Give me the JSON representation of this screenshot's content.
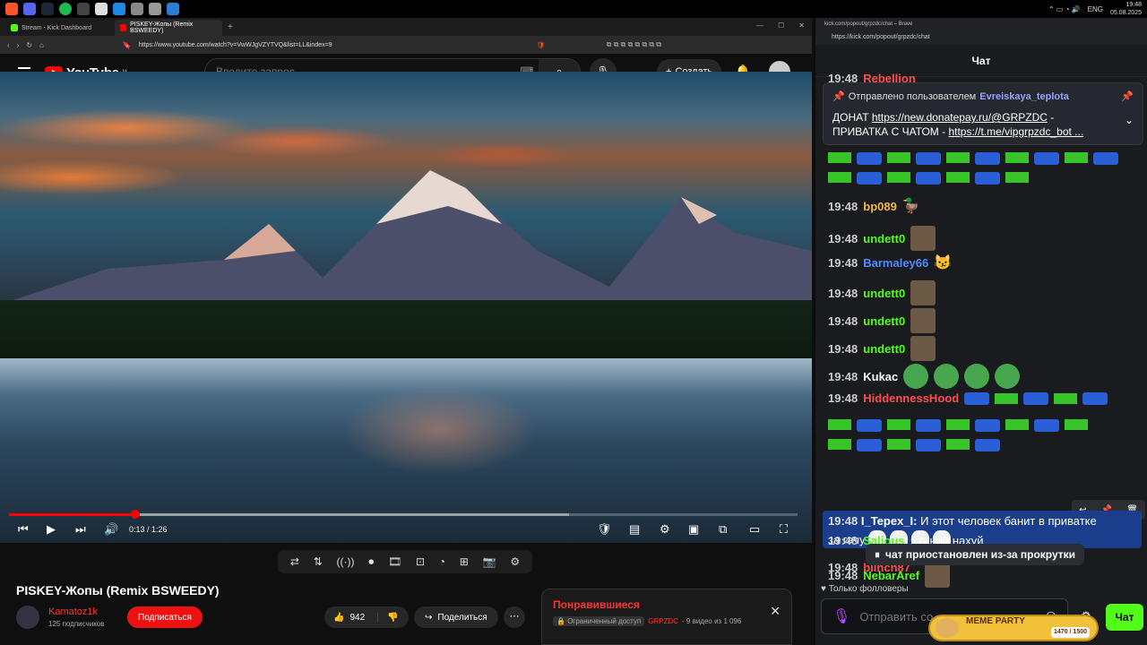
{
  "taskbar": {
    "clock_time": "19:48",
    "clock_date": "05.08.2025",
    "lang": "ENG"
  },
  "left_browser": {
    "tabs": [
      {
        "label": "Stream - Kick Dashboard"
      },
      {
        "label": "PISKEY-Жопы (Remix BSWEEDY)"
      }
    ],
    "url": "https://www.youtube.com/watch?v=VwWJgVZYTVQ&list=LL&index=9"
  },
  "youtube": {
    "logo": "YouTube",
    "region": "NL",
    "search_placeholder": "Введите запрос",
    "create_label": "Создать",
    "video_title": "PISKEY-Жопы (Remix BSWEEDY)",
    "time": "0:13 / 1:26",
    "progress": 0.16,
    "buffered": 0.71,
    "channel_name": "Kamatoz1k",
    "subscribers": "125 подписчиков",
    "subscribe_label": "Подписаться",
    "likes": "942",
    "share_label": "Поделиться",
    "playlist": {
      "title": "Понравившиеся",
      "access": "Ограниченный доступ",
      "owner": "GRPZDC",
      "info": "- 9 видео из 1 096"
    }
  },
  "chat_window": {
    "title": "kick.com/popout/grpzdc/chat – Brave",
    "url": "https://kick.com/popout/grpzdc/chat",
    "header": "Чат",
    "pinned": {
      "by_label": "Отправлено пользователем",
      "user": "Evreiskaya_teplota",
      "line1_prefix": "ДОНАТ ",
      "line1_link": "https://new.donatepay.ru/@GRPZDC",
      "line1_suffix": " -",
      "line2_prefix": "ПРИВАТКА С ЧАТОМ - ",
      "line2_link": "https://t.me/vipgrpzdc_bot ..."
    },
    "messages": [
      {
        "time": "19:48",
        "user": "Rebellion",
        "color": "#ff4d4d"
      },
      {
        "time": "19:48",
        "user": "bp089",
        "color": "#f5b642"
      },
      {
        "time": "19:48",
        "user": "undett0",
        "color": "#53fc18"
      },
      {
        "time": "19:48",
        "user": "Barmaley66",
        "color": "#4a8cff"
      },
      {
        "time": "19:48",
        "user": "undett0",
        "color": "#53fc18"
      },
      {
        "time": "19:48",
        "user": "undett0",
        "color": "#53fc18"
      },
      {
        "time": "19:48",
        "user": "undett0",
        "color": "#53fc18"
      },
      {
        "time": "19:48",
        "user": "Kukac",
        "color": "#ffffff"
      },
      {
        "time": "19:48",
        "user": "HiddennessHood",
        "color": "#ff4d4d"
      },
      {
        "time": "19:48",
        "user": "NebarAref",
        "color": "#53fc18"
      },
      {
        "time": "19:48",
        "user": "Salious",
        "color": "#53fc18"
      },
      {
        "time": "19:48",
        "user": "blinch87",
        "color": "#ff4d4d"
      }
    ],
    "highlighted": {
      "time": "19:48",
      "user": "I_Tepex_I",
      "text": "И этот человек банит в приватке",
      "text2": "за гачу"
    },
    "salious_text": "гений нахуй",
    "paused_text": "чат приостановлен из-за прокрутки",
    "followers_only": "Только фолловеры",
    "input_placeholder": "Отправить со...",
    "send_label": "Чат",
    "meme_party": {
      "title": "MEME PARTY",
      "count": "1470 / 1500"
    }
  }
}
